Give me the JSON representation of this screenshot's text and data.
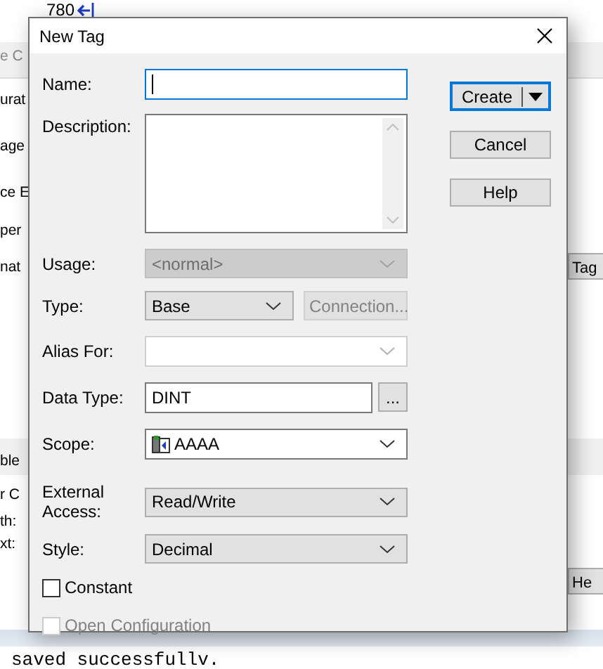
{
  "background": {
    "page_number": "780",
    "fragments": [
      "e C",
      "urat",
      "age",
      "ce E",
      "per",
      "nat",
      "ble",
      "r C",
      "th:",
      "xt:"
    ],
    "buttons": [
      "Tag",
      "He"
    ],
    "status_text": "saved successfullv."
  },
  "dialog": {
    "title": "New Tag",
    "fields": [
      {
        "kind": "text",
        "label": "Name:",
        "focused": true
      },
      {
        "kind": "textarea",
        "label": "Description:"
      },
      {
        "kind": "dropdown",
        "label": "Usage:",
        "value": "<normal>",
        "disabled": true
      },
      {
        "kind": "dropdown",
        "label": "Type:",
        "value": "Base",
        "disabled": false,
        "side_button": {
          "label": "Connection...",
          "disabled": true
        }
      },
      {
        "kind": "combo",
        "label": "Alias For:",
        "disabled": true
      },
      {
        "kind": "text",
        "label": "Data Type:",
        "value": "DINT",
        "focused": false,
        "side_button": {
          "label": "...",
          "disabled": false
        }
      },
      {
        "kind": "combo",
        "label": "Scope:",
        "value": "AAAA",
        "icon": true,
        "disabled": false
      },
      {
        "kind": "dropdown",
        "label": "External Access:",
        "value": "Read/Write",
        "disabled": false
      },
      {
        "kind": "dropdown",
        "label": "Style:",
        "value": "Decimal",
        "disabled": false
      },
      {
        "kind": "checkbox",
        "label": "Constant",
        "checked": false,
        "disabled": false
      },
      {
        "kind": "checkbox",
        "label": "Open Configuration",
        "checked": false,
        "disabled": true
      }
    ],
    "buttons": [
      {
        "label": "Create",
        "default": true,
        "split": true
      },
      {
        "label": "Cancel",
        "default": false,
        "split": false
      },
      {
        "label": "Help",
        "default": false,
        "split": false
      }
    ]
  }
}
